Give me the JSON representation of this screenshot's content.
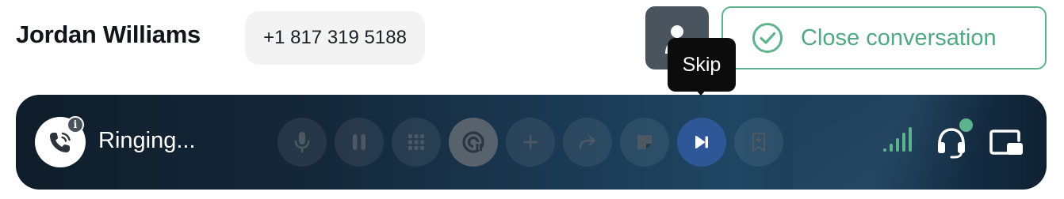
{
  "header": {
    "contact_name": "Jordan Williams",
    "phone": "+1 817 319 5188",
    "assign_icon": "person-icon",
    "close_label": "Close conversation",
    "close_icon": "check-circle-icon"
  },
  "call_bar": {
    "status": "Ringing...",
    "status_icon": "phone-ringing-icon",
    "info_icon": "info-icon",
    "controls": [
      {
        "name": "mute",
        "icon": "microphone-icon"
      },
      {
        "name": "hold",
        "icon": "pause-icon"
      },
      {
        "name": "keypad",
        "icon": "keypad-icon"
      },
      {
        "name": "record",
        "icon": "record-icon"
      },
      {
        "name": "add-participant",
        "icon": "plus-icon"
      },
      {
        "name": "transfer",
        "icon": "transfer-icon"
      },
      {
        "name": "note",
        "icon": "note-icon"
      },
      {
        "name": "skip",
        "icon": "skip-icon"
      },
      {
        "name": "bookmark",
        "icon": "bookmark-icon"
      }
    ],
    "right_icons": [
      "signal-icon",
      "headset-icon",
      "picture-in-picture-icon"
    ],
    "presence": "available"
  },
  "tooltip": {
    "text": "Skip"
  },
  "colors": {
    "accent_green": "#5cb38d",
    "call_bar_dark": "#0f1d2a",
    "skip_active": "#2d5796",
    "record_active": "#57626c"
  }
}
